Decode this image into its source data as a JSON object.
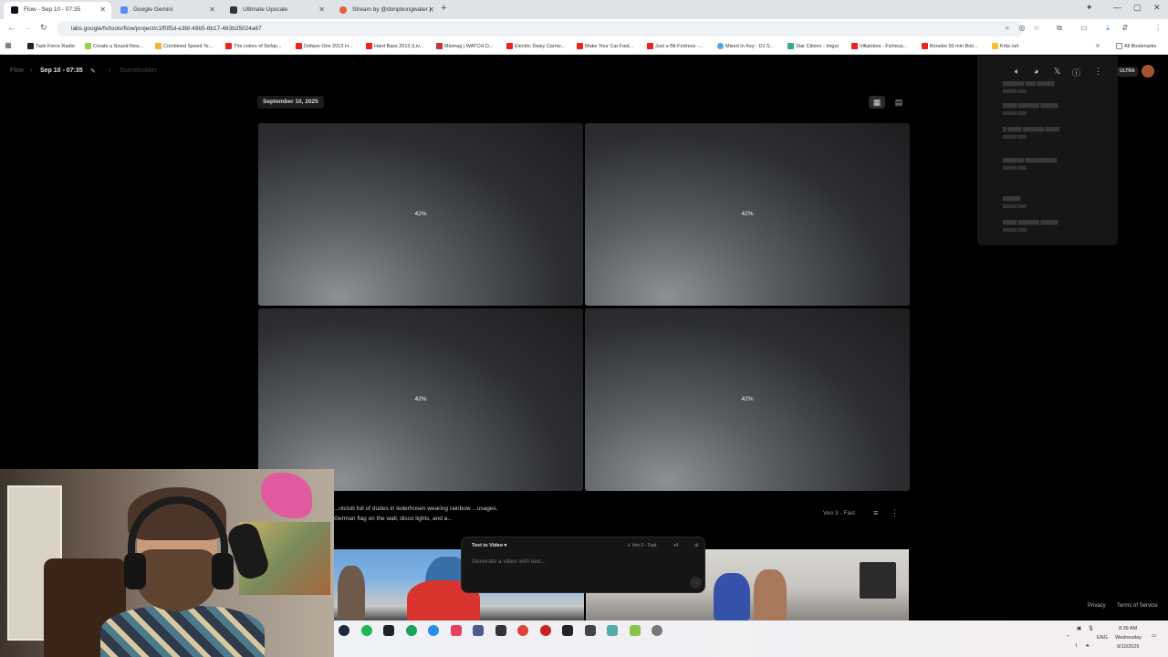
{
  "browser": {
    "tabs": [
      {
        "title": "Flow - Sep 10 - 07:35",
        "active": true
      },
      {
        "title": "Google Gemini",
        "active": false
      },
      {
        "title": "Ultimate Upscale",
        "active": false
      },
      {
        "title": "Stream by @donpbongwater |",
        "active": false
      }
    ],
    "url": "labs.google/fx/tools/flow/project/c1ff0f5d-e3bf-49b5-8b17-483b25024a67",
    "bookmarks": [
      "Task Force Radio",
      "Create a Sound Rea...",
      "Combined Speed Te...",
      "The colors of Defqo...",
      "Defqon One 2013 H...",
      "Hard Bass 2013 (Liv...",
      "Mixmag | WATCH D...",
      "Electric Daisy Carniv...",
      "Make Your Car Fast...",
      "Just a Bit Fortress -...",
      "Mixed In Key - DJ S...",
      "Star Citizen - Imgur",
      "Villalobos - Fizheus...",
      "Bonobo 50 min Boil...",
      "Kritz.net"
    ],
    "all_bookmarks": "All Bookmarks"
  },
  "app": {
    "breadcrumb": {
      "root": "Flow",
      "project": "Sep 10 - 07:35",
      "section": "Scenebuilder"
    },
    "date_label": "September 10, 2025",
    "tiles": [
      {
        "progress": "42%"
      },
      {
        "progress": "42%"
      },
      {
        "progress": "42%"
      },
      {
        "progress": "42%"
      }
    ],
    "prompt_text": "...ntclub full of dudes in lederhosen wearing rainbow ...usages. German flag on the wall, disco lights, and a...",
    "model_badge": "Veo 3 - Fast",
    "composer": {
      "mode": "Text to Video",
      "model": "Veo 3 - Fast",
      "count": "x4",
      "placeholder": "Generate a video with text..."
    },
    "plan_badge": "ULTRA",
    "footer": {
      "privacy": "Privacy",
      "terms": "Terms of Service"
    }
  },
  "taskbar": {
    "language": "ENG",
    "time": "8:39 AM",
    "day": "Wednesday",
    "date": "9/10/2025"
  }
}
